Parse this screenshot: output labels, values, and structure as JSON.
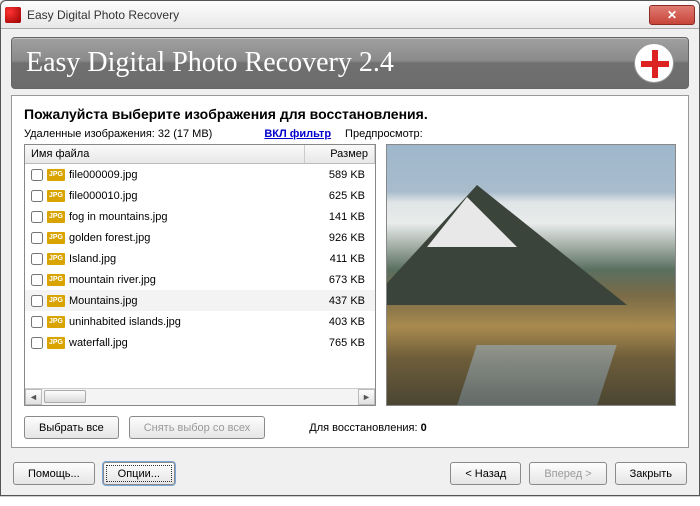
{
  "window": {
    "title": "Easy Digital Photo Recovery"
  },
  "banner": {
    "title": "Easy Digital Photo Recovery 2.4"
  },
  "panel": {
    "heading": "Пожалуйста выберите изображения для восстановления.",
    "deleted_label": "Удаленные изображения: 32 (17 MB)",
    "filter_label": "ВКЛ фильтр",
    "preview_label": "Предпросмотр:",
    "columns": {
      "name": "Имя файла",
      "size": "Размер"
    },
    "files": [
      {
        "name": "file000009.jpg",
        "size": "589 KB",
        "selected": false
      },
      {
        "name": "file000010.jpg",
        "size": "625 KB",
        "selected": false
      },
      {
        "name": "fog in mountains.jpg",
        "size": "141 KB",
        "selected": false
      },
      {
        "name": "golden forest.jpg",
        "size": "926 KB",
        "selected": false
      },
      {
        "name": "Island.jpg",
        "size": "411 KB",
        "selected": false
      },
      {
        "name": "mountain river.jpg",
        "size": "673 KB",
        "selected": false
      },
      {
        "name": "Mountains.jpg",
        "size": "437 KB",
        "selected": true
      },
      {
        "name": "uninhabited islands.jpg",
        "size": "403 KB",
        "selected": false
      },
      {
        "name": "waterfall.jpg",
        "size": "765 KB",
        "selected": false
      }
    ],
    "icon_badge": "JPG",
    "select_all": "Выбрать все",
    "deselect_all": "Снять выбор со всех",
    "recover_label": "Для восстановления: ",
    "recover_count": "0"
  },
  "footer": {
    "help": "Помощь...",
    "options": "Опции...",
    "back": "< Назад",
    "forward": "Вперед >",
    "close": "Закрыть"
  }
}
